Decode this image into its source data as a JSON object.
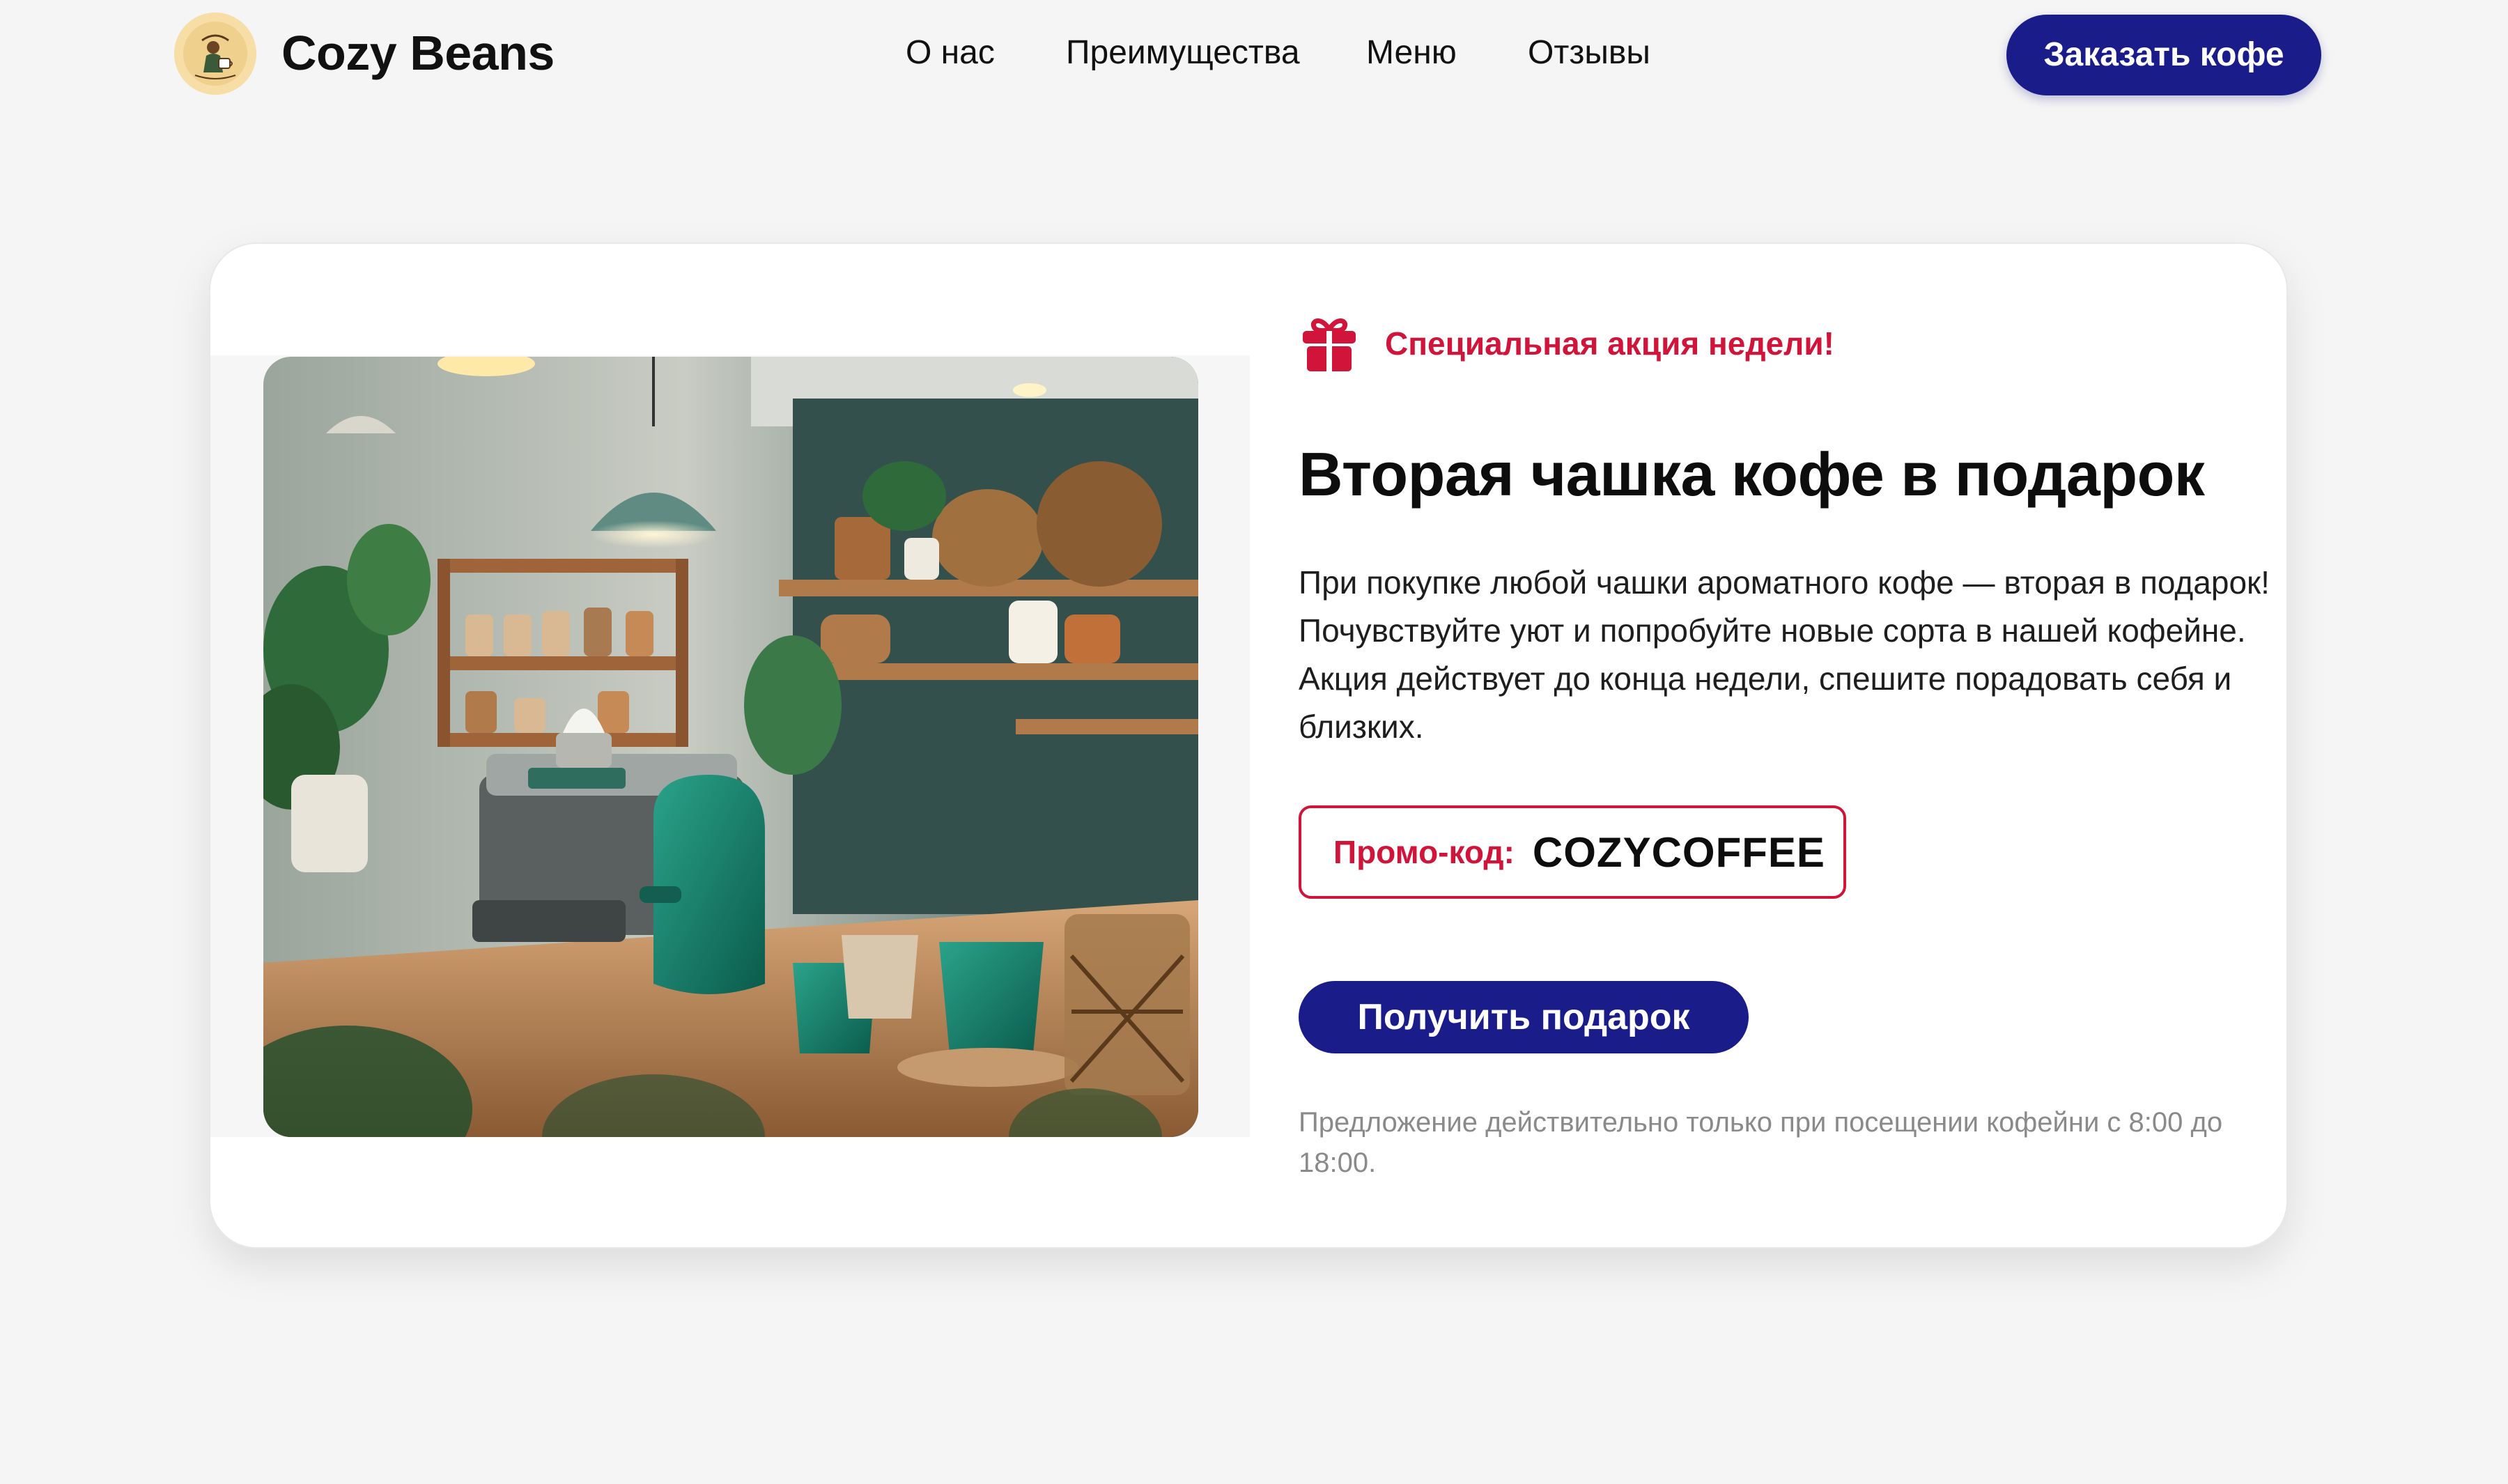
{
  "header": {
    "brand": "Cozy Beans",
    "logo_icon": "coffee-cup-barista-logo",
    "nav": [
      {
        "label": "О нас"
      },
      {
        "label": "Преимущества"
      },
      {
        "label": "Меню"
      },
      {
        "label": "Отзывы"
      }
    ],
    "order_button": "Заказать кофе"
  },
  "promo": {
    "badge_icon": "gift-icon",
    "badge_text": "Специальная акция недели!",
    "title": "Вторая чашка кофе в подарок",
    "description": "При покупке любой чашки ароматного кофе — вторая в подарок! Почувствуйте уют и попробуйте новые сорта в нашей кофейне. Акция действует до конца недели, спешите порадовать себя и близких.",
    "promo_key": "Промо-код:",
    "promo_code": "COZYCOFFEE",
    "cta_button": "Получить подарок",
    "note": "Предложение действительно только при посещении кофейни с 8:00 до 18:00."
  },
  "colors": {
    "accent_navy": "#1a1c8a",
    "accent_red": "#d0143a",
    "background": "#f5f5f5",
    "card": "#ffffff"
  }
}
